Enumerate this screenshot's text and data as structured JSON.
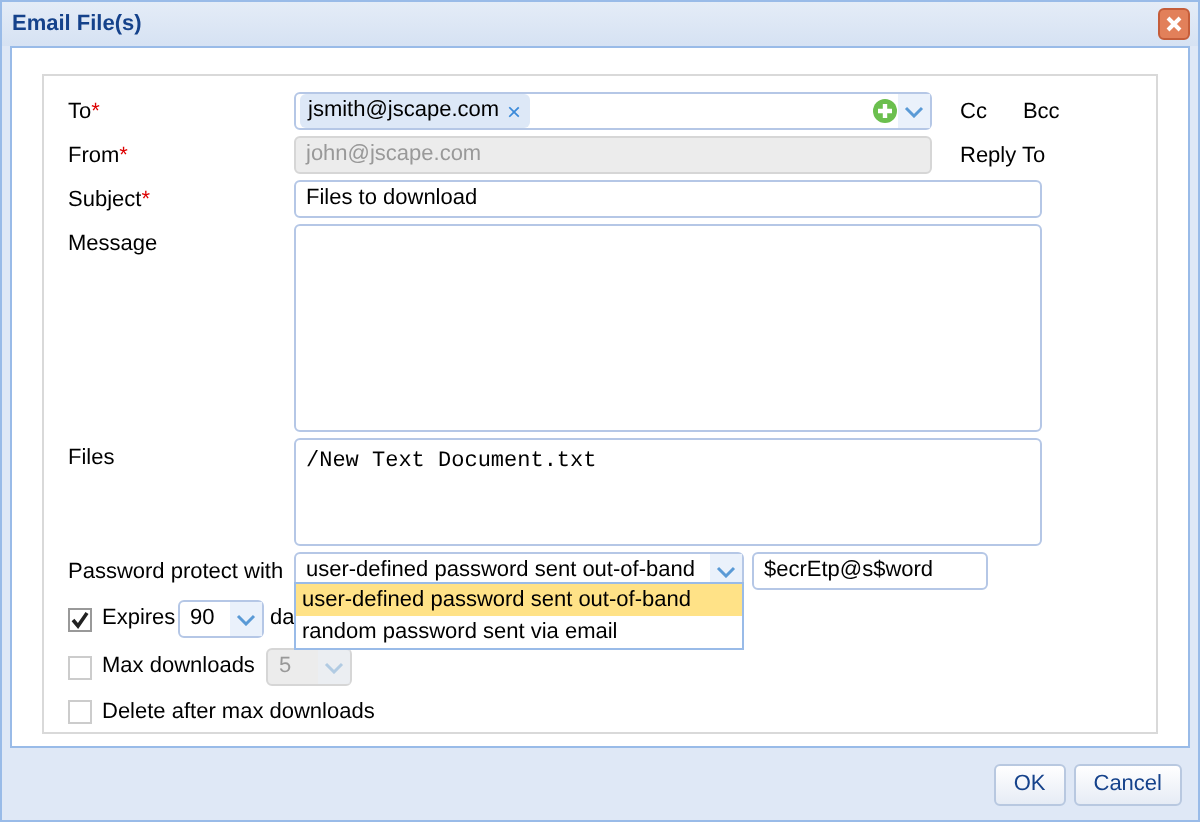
{
  "window": {
    "title": "Email File(s)"
  },
  "to": {
    "label": "To",
    "required_mark": "*",
    "recipients": [
      {
        "address": "jsmith@jscape.com"
      }
    ],
    "remove_glyph": "×"
  },
  "cc": "Cc",
  "bcc": "Bcc",
  "from": {
    "label": "From",
    "required_mark": "*",
    "value": "john@jscape.com",
    "disabled": true
  },
  "reply_to": "Reply To",
  "subject": {
    "label": "Subject",
    "required_mark": "*",
    "value": "Files to download"
  },
  "message": {
    "label": "Message"
  },
  "files": {
    "label": "Files",
    "value": "/New Text Document.txt"
  },
  "password": {
    "label": "Password protect with",
    "value": "user-defined password sent out-of-band",
    "secret": "$ecrEtp@s$word",
    "expanded": true,
    "options": [
      {
        "label": "user-defined password sent out-of-band",
        "selected": true
      },
      {
        "label": "random password sent via email",
        "selected": false
      }
    ]
  },
  "expires": {
    "label": "Expires",
    "checked": true,
    "value": "90",
    "unit": "da"
  },
  "max_downloads": {
    "label": "Max downloads",
    "checked": false,
    "value": "5",
    "disabled": true
  },
  "delete_after": {
    "label": "Delete after max downloads",
    "checked": false
  },
  "buttons": [
    "OK",
    "Cancel"
  ]
}
